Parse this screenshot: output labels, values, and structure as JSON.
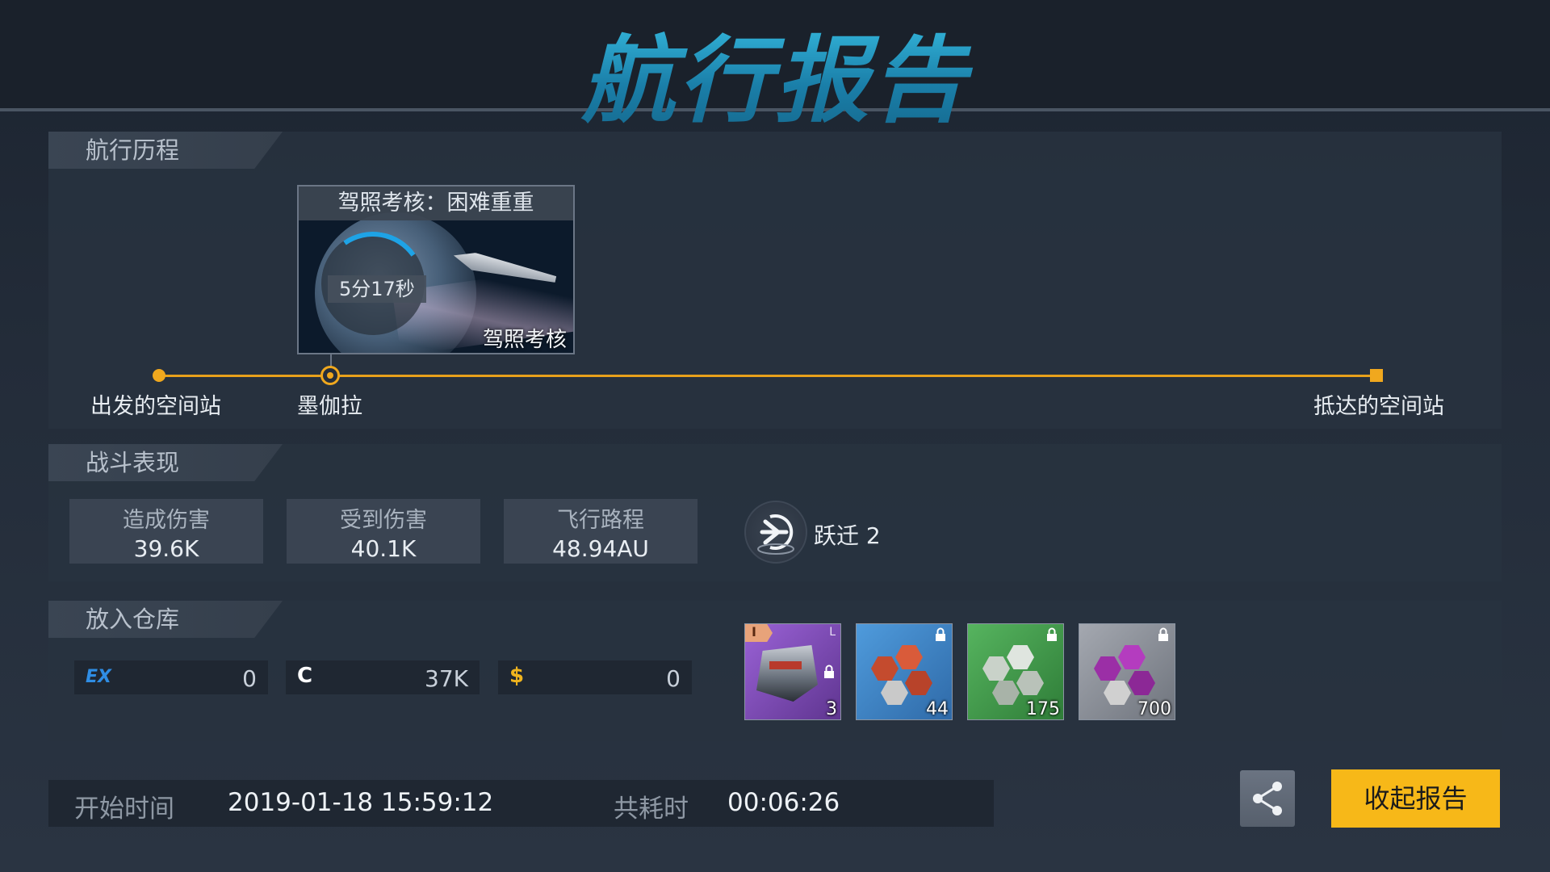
{
  "header": {
    "title": "航行报告"
  },
  "voyage": {
    "tab_label": "航行历程",
    "event_card": {
      "title": "驾照考核：困难重重",
      "timer": "5分17秒",
      "type_label": "驾照考核"
    },
    "nodes": {
      "start": "出发的空间站",
      "waypoint": "墨伽拉",
      "end": "抵达的空间站"
    }
  },
  "combat": {
    "tab_label": "战斗表现",
    "stats": [
      {
        "label": "造成伤害",
        "value": "39.6K"
      },
      {
        "label": "受到伤害",
        "value": "40.1K"
      },
      {
        "label": "飞行路程",
        "value": "48.94AU"
      }
    ],
    "warp_label": "跃迁 2"
  },
  "storage": {
    "tab_label": "放入仓库",
    "currencies": [
      {
        "icon": "EX",
        "value": "0",
        "color": "#2f8de4"
      },
      {
        "icon": "C",
        "value": "37K",
        "color": "#ffffff"
      },
      {
        "icon": "$",
        "value": "0",
        "color": "#f0b41e"
      }
    ],
    "items": [
      {
        "name": "turret-module-icon",
        "count": "3",
        "color": "#7d4fb8",
        "tier": "I",
        "size": "L"
      },
      {
        "name": "orange-crystal-icon",
        "count": "44",
        "color": "#3b80c4"
      },
      {
        "name": "green-crystal-icon",
        "count": "175",
        "color": "#3e9a48"
      },
      {
        "name": "purple-crystal-icon",
        "count": "700",
        "color": "#8b8f97"
      }
    ]
  },
  "footer": {
    "start_time_label": "开始时间",
    "start_time_value": "2019-01-18 15:59:12",
    "duration_label": "共耗时",
    "duration_value": "00:06:26",
    "collapse_label": "收起报告"
  },
  "colors": {
    "accent": "#f7b818",
    "route": "#e8a11b",
    "title": "#1f8fb5"
  }
}
